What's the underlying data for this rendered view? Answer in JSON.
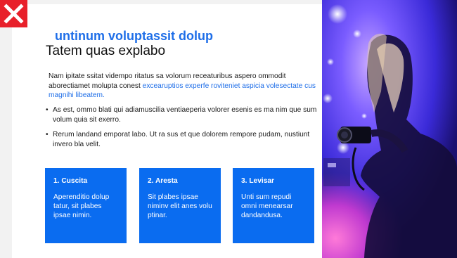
{
  "modal": {
    "close_icon": "close-x-icon",
    "eyebrow": "untinum voluptassit dolup",
    "heading": "Tatem quas explabo",
    "intro_text": "Nam ipitate ssitat vidempo ritatus sa volorum receaturibus aspero ommodit aborectiamet molupta conest ",
    "intro_link": "excearuptios experfe roviteniet aspicia volesectate cus magnihi libeatem.",
    "bullets": [
      "As est, ommo blati qui adiamuscilia ventiaeperia volorer esenis es ma nim que sum volum quia sit exerro.",
      "Rerum landand emporat labo. Ut ra sus et que dolorem rempore pudam, nustiunt invero bla velit."
    ],
    "tiles": [
      {
        "title": "1. Cuscita",
        "body": "Aperenditio dolup tatur, sit plabes ipsae nimin."
      },
      {
        "title": "2. Aresta",
        "body": "Sit plabes ipsae niminv elit anes volu ptinar."
      },
      {
        "title": "3. Levisar",
        "body": "Unti sum repudi omni menearsar dandandusa."
      }
    ]
  },
  "colors": {
    "accent": "#1e6ee8",
    "tile_bg": "#0a6cf0",
    "close_bg": "#e8202a",
    "page_bg": "#f2f2f2"
  },
  "photo": {
    "subject": "photographer-with-camera-at-concert"
  }
}
